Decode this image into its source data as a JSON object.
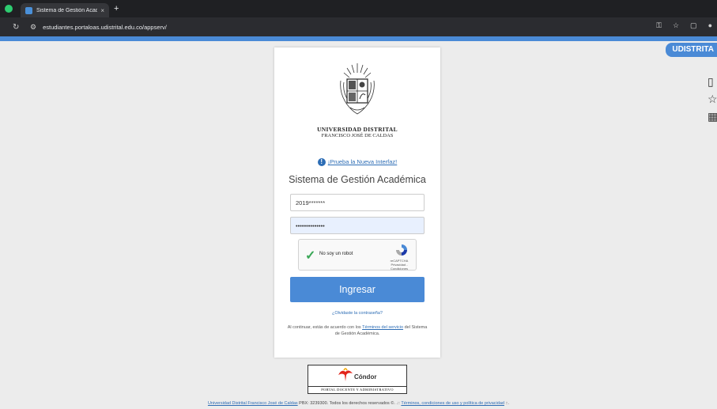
{
  "browser": {
    "tab_title": "Sistema de Gestión Académ",
    "tab_close": "×",
    "new_tab": "+",
    "url": "estudiantes.portaloas.udistrital.edu.co/appserv/"
  },
  "page": {
    "side_tab": "UDISTRITA",
    "university_name": "UNIVERSIDAD DISTRITAL",
    "university_sub": "FRANCISCO JOSÉ DE CALDAS",
    "try_new_interface": "¡Prueba la Nueva Interfaz!",
    "system_title": "Sistema de Gestión Académica",
    "username_value": "2019*******",
    "password_value": "••••••••••••••",
    "captcha_label": "No soy un robot",
    "captcha_brand": "reCAPTCHA",
    "captcha_links": "Privacidad - Condiciones",
    "login_button": "Ingresar",
    "forgot_password": "¿Olvidaste la contraseña?",
    "terms_prefix": "Al continuar, estás de acuerdo con los ",
    "terms_link": "Términos del servicio",
    "terms_suffix": " del Sistema de Gestión Académica."
  },
  "condor": {
    "name": "Cóndor",
    "subtitle": "PORTAL DOCENTE Y ADMINISTRATIVO"
  },
  "footer": {
    "link1": "Universidad Distrital Francisco José de Caldas",
    "text": " PBX: 3239300. Todos los derechos reservados ©. .:: ",
    "link2": "Términos, condiciones de uso y política de privacidad",
    "end": " ::."
  },
  "colors": {
    "accent": "#4a8ad6",
    "link": "#2d6db5"
  }
}
